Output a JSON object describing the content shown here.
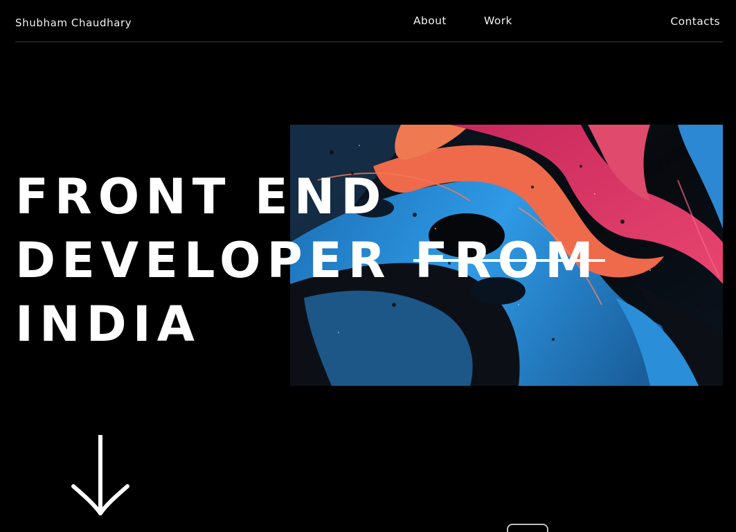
{
  "header": {
    "brand": "Shubham Chaudhary",
    "nav": {
      "about": "About",
      "work": "Work",
      "contacts": "Contacts"
    }
  },
  "hero": {
    "headline": {
      "line1": "FRONT END",
      "line2_plain": "DEVELOPER ",
      "line2_struck": "FROM",
      "line3": "INDIA"
    },
    "image": {
      "icon": "abstract-fluid-paint-image",
      "colors": [
        "#2a8fd8",
        "#e23a6a",
        "#ef6a4a",
        "#111418"
      ]
    }
  },
  "scroll": {
    "arrow_icon": "arrow-down-icon",
    "pill_icon": "scroll-pill-indicator"
  },
  "colors": {
    "background": "#000000",
    "text": "#ffffff",
    "divider": "#3a3a3a"
  }
}
